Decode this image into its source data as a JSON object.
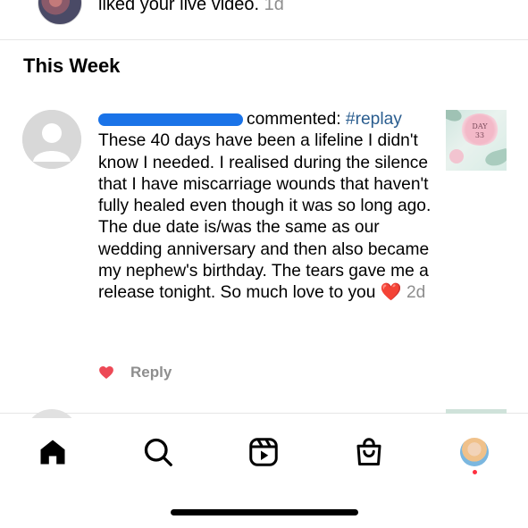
{
  "previous_item": {
    "text": "liked your live video.",
    "time": "1d"
  },
  "section": {
    "title": "This Week"
  },
  "notification": {
    "action": "commented:",
    "hashtag": "#replay",
    "comment": "These 40 days have been a lifeline I didn't know I needed.  I realised during the silence that I have miscarriage wounds that haven't fully healed even though it was so long ago. The due date is/was the same as our wedding anniversary and then also became my nephew's birthday. The tears gave me a release tonight. So much love to you",
    "emoji": "❤️",
    "time": "2d",
    "thumbnail_text": "DAY 33",
    "reply_label": "Reply"
  },
  "tabbar": {
    "items": [
      "home-icon",
      "search-icon",
      "reels-icon",
      "shop-icon",
      "profile-avatar"
    ],
    "notification_dot_color": "#ff3040"
  },
  "colors": {
    "hashtag": "#2a5d8f",
    "secondary_text": "#8e8e8e",
    "like_heart": "#ed4956"
  }
}
